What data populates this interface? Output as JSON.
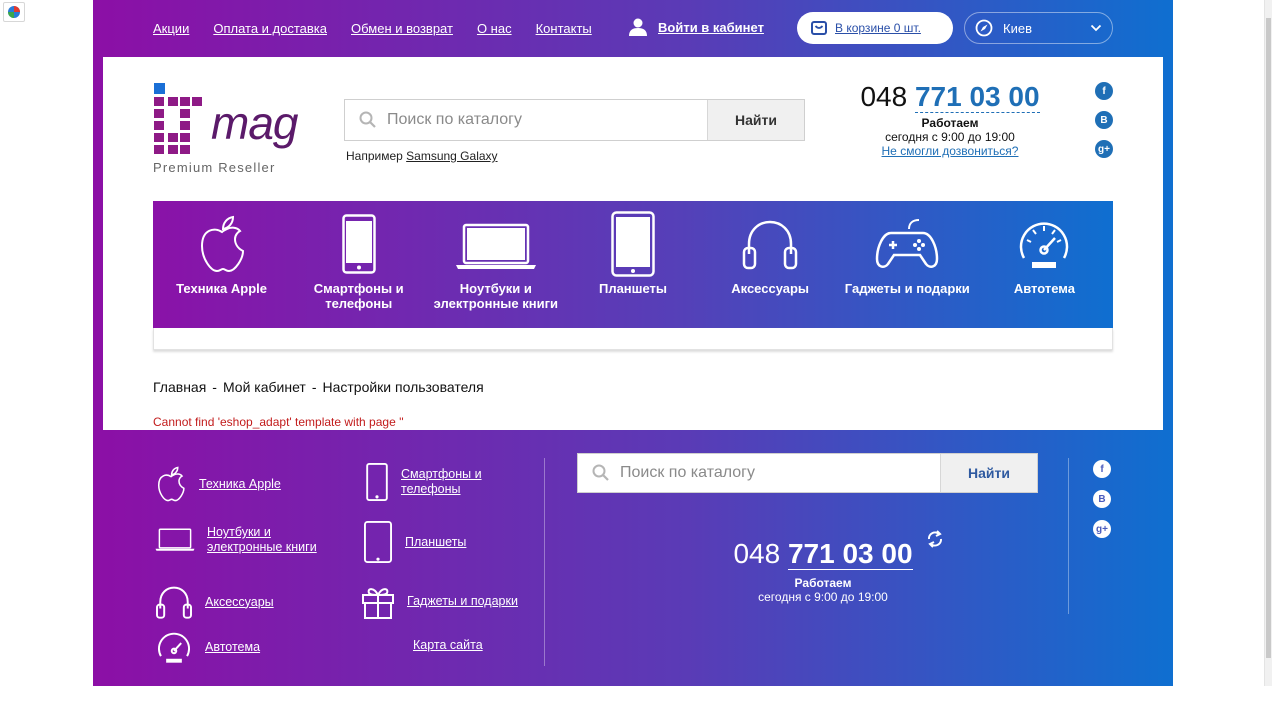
{
  "top_links": [
    "Акции",
    "Оплата и доставка",
    "Обмен и возврат",
    "О нас",
    "Контакты"
  ],
  "login_label": "Войти в кабинет",
  "cart_label": "В корзине 0 шт.",
  "city": "Киев",
  "logo": {
    "brand_it": "iT",
    "brand_mag": "mag",
    "tagline": "Premium Reseller"
  },
  "search": {
    "placeholder": "Поиск по каталогу",
    "button": "Найти",
    "example_prefix": "Например",
    "example_link": "Samsung Galaxy"
  },
  "phone": {
    "code": "048",
    "number": "771 03 00",
    "works": "Работаем",
    "hours": "сегодня с 9:00 до 19:00",
    "cant_call": "Не смогли дозвониться?"
  },
  "social": [
    "f",
    "B",
    "g+"
  ],
  "categories": [
    "Техника Apple",
    "Смартфоны и телефоны",
    "Ноутбуки и электронные книги",
    "Планшеты",
    "Аксессуары",
    "Гаджеты и подарки",
    "Автотема"
  ],
  "breadcrumbs": [
    "Главная",
    "Мой кабинет",
    "Настройки пользователя"
  ],
  "breadcrumb_sep": "-",
  "error_text": "Cannot find 'eshop_adapt' template with page ''",
  "footer_links": [
    "Техника Apple",
    "Смартфоны и телефоны",
    "Ноутбуки и электронные книги",
    "Планшеты",
    "Аксессуары",
    "Гаджеты и подарки",
    "Автотема",
    "Карта сайта"
  ],
  "colors": {
    "gradient_left": "#8c0fa6",
    "gradient_right": "#0f6fd0",
    "phone_blue": "#1f6fb6",
    "error_red": "#c21c1c"
  }
}
